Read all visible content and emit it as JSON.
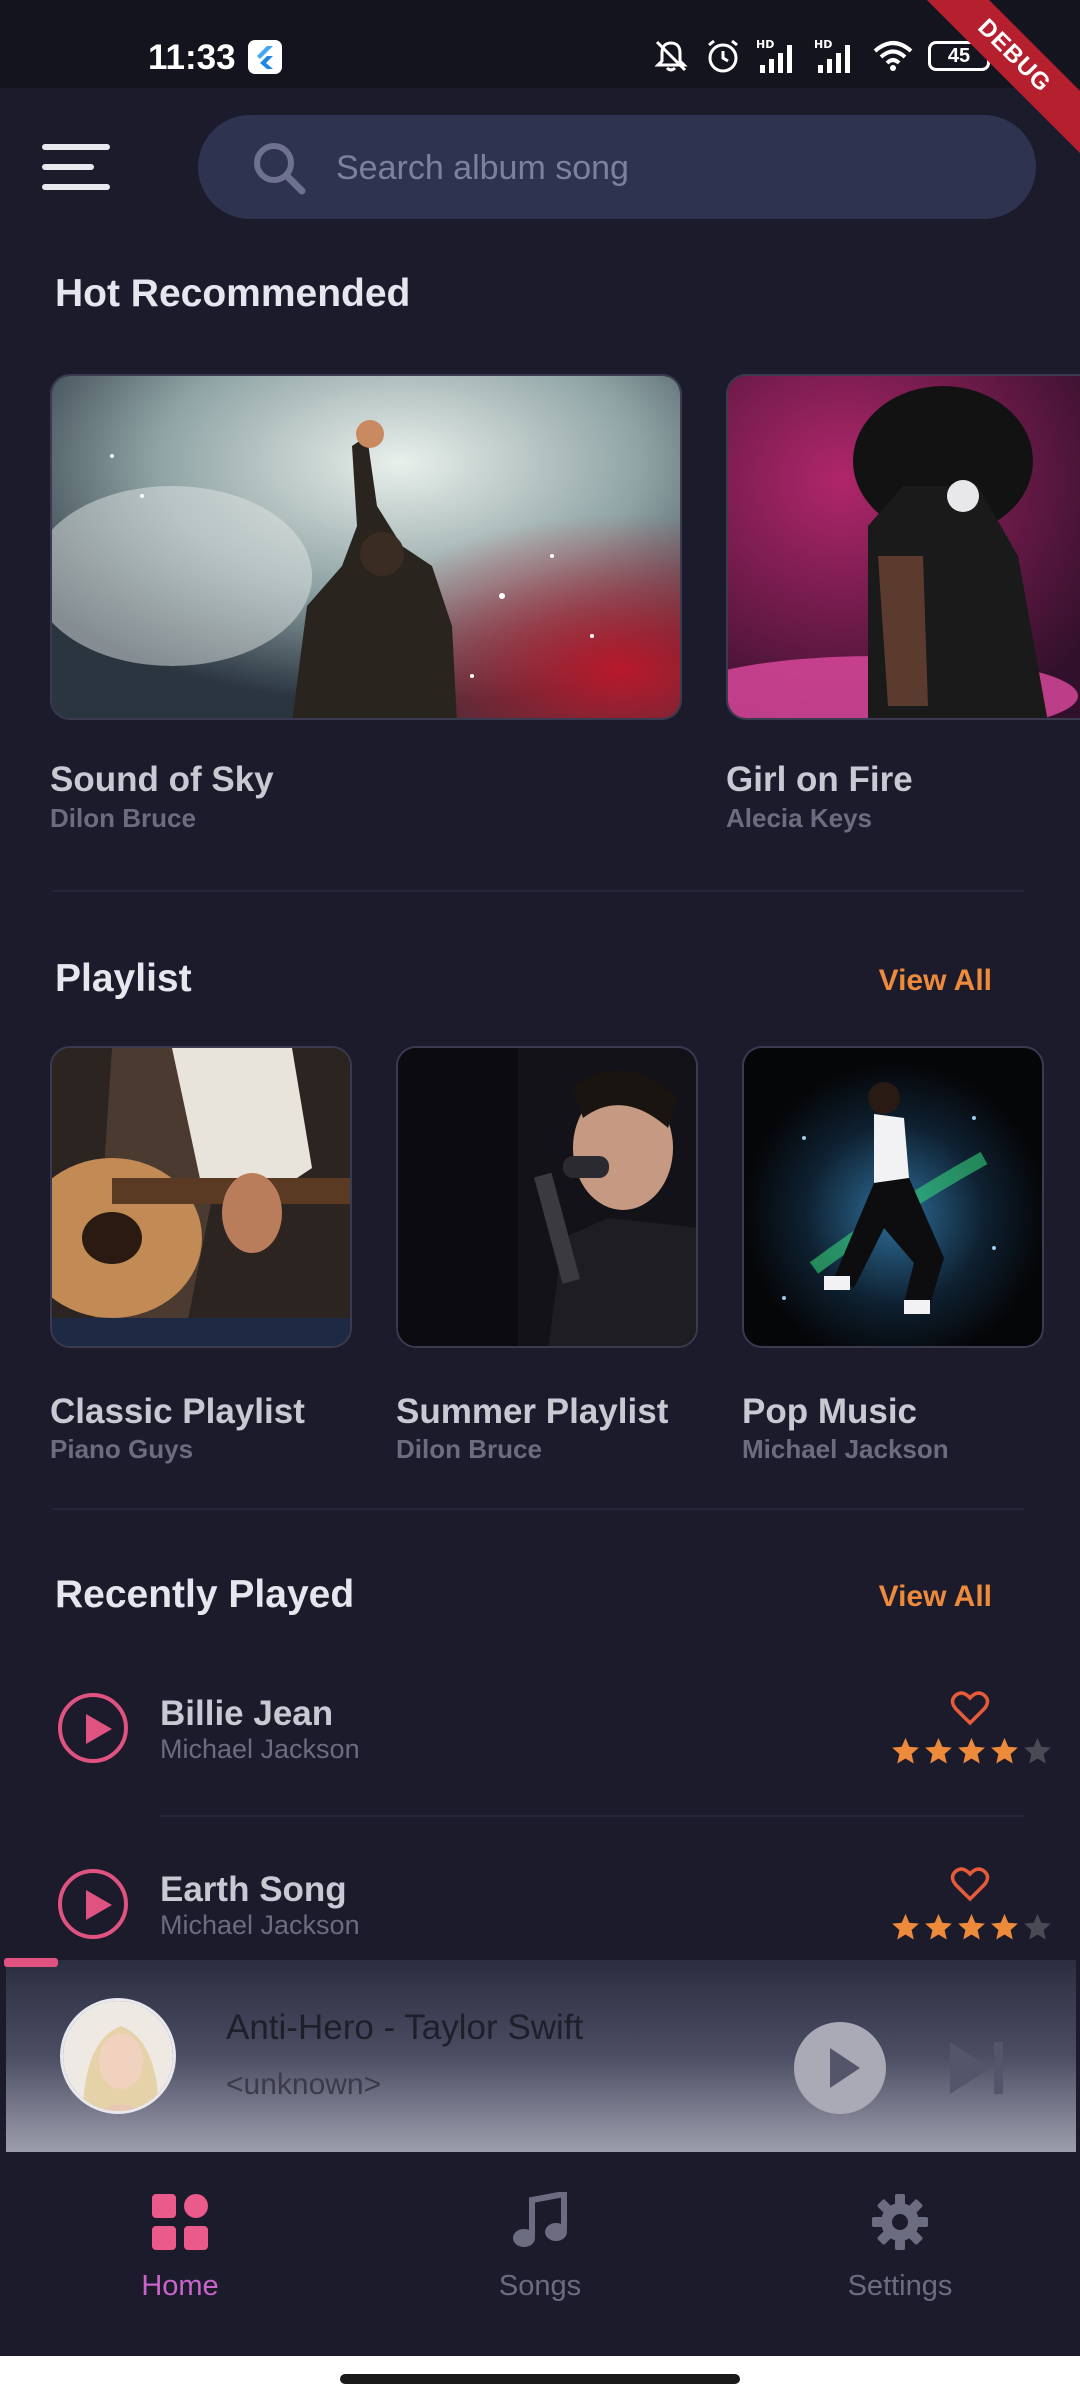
{
  "status_bar": {
    "time": "11:33",
    "battery": "45",
    "debug_label": "DEBUG"
  },
  "search": {
    "placeholder": "Search album song"
  },
  "hot_recommended": {
    "title": "Hot Recommended",
    "items": [
      {
        "title": "Sound of Sky",
        "artist": "Dilon Bruce"
      },
      {
        "title": "Girl on Fire",
        "artist": "Alecia Keys"
      }
    ]
  },
  "playlist": {
    "title": "Playlist",
    "view_all": "View All",
    "items": [
      {
        "title": "Classic Playlist",
        "artist": "Piano Guys"
      },
      {
        "title": "Summer Playlist",
        "artist": "Dilon Bruce"
      },
      {
        "title": "Pop Music",
        "artist": "Michael Jackson"
      }
    ]
  },
  "recently_played": {
    "title": "Recently Played",
    "view_all": "View All",
    "items": [
      {
        "title": "Billie Jean",
        "artist": "Michael Jackson",
        "rating": 4
      },
      {
        "title": "Earth Song",
        "artist": "Michael Jackson",
        "rating": 4
      }
    ]
  },
  "mini_player": {
    "title": "Anti-Hero - Taylor Swift",
    "subtitle": "<unknown>",
    "progress": 0.05
  },
  "bottom_nav": {
    "items": [
      {
        "label": "Home",
        "icon": "grid-icon",
        "active": true
      },
      {
        "label": "Songs",
        "icon": "music-note-icon",
        "active": false
      },
      {
        "label": "Settings",
        "icon": "gear-icon",
        "active": false
      }
    ]
  },
  "colors": {
    "background": "#1b1b2b",
    "accent_orange": "#ee8a3b",
    "accent_pink": "#e0527f",
    "active_nav": "#c964c8",
    "inactive_nav": "#6c6c80"
  }
}
